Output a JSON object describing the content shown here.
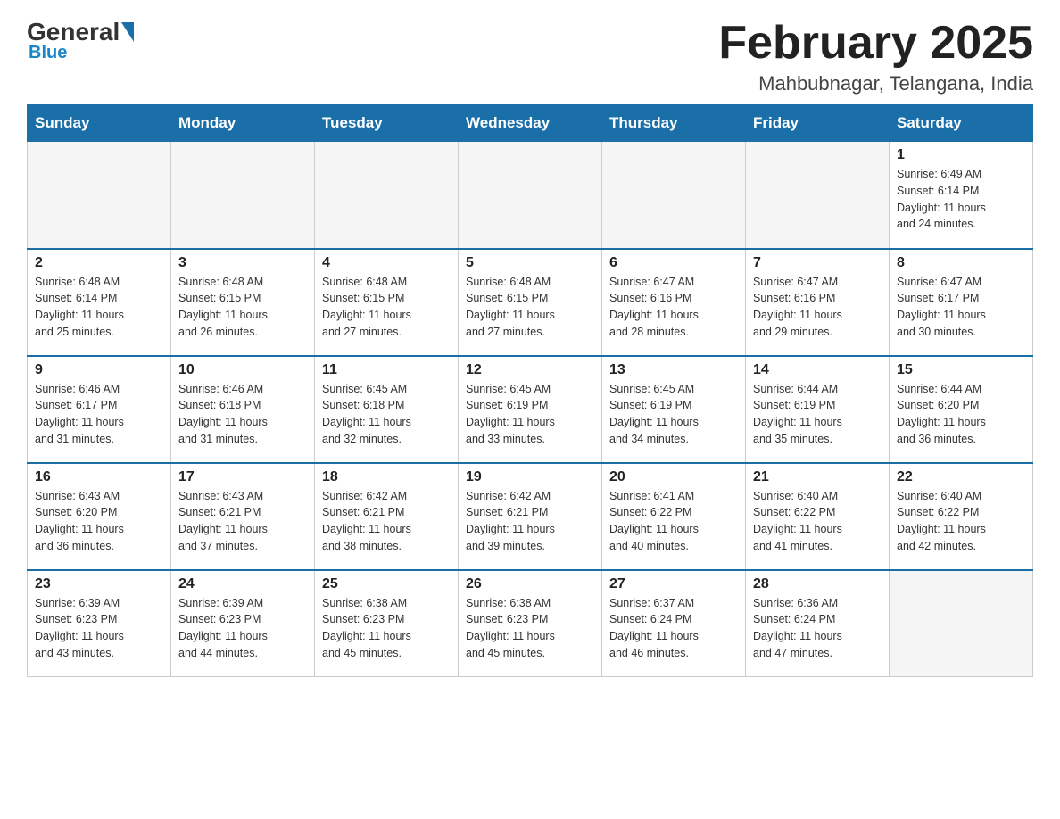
{
  "logo": {
    "general": "General",
    "blue": "Blue"
  },
  "title": "February 2025",
  "subtitle": "Mahbubnagar, Telangana, India",
  "headers": [
    "Sunday",
    "Monday",
    "Tuesday",
    "Wednesday",
    "Thursday",
    "Friday",
    "Saturday"
  ],
  "weeks": [
    [
      {
        "day": "",
        "info": ""
      },
      {
        "day": "",
        "info": ""
      },
      {
        "day": "",
        "info": ""
      },
      {
        "day": "",
        "info": ""
      },
      {
        "day": "",
        "info": ""
      },
      {
        "day": "",
        "info": ""
      },
      {
        "day": "1",
        "info": "Sunrise: 6:49 AM\nSunset: 6:14 PM\nDaylight: 11 hours\nand 24 minutes."
      }
    ],
    [
      {
        "day": "2",
        "info": "Sunrise: 6:48 AM\nSunset: 6:14 PM\nDaylight: 11 hours\nand 25 minutes."
      },
      {
        "day": "3",
        "info": "Sunrise: 6:48 AM\nSunset: 6:15 PM\nDaylight: 11 hours\nand 26 minutes."
      },
      {
        "day": "4",
        "info": "Sunrise: 6:48 AM\nSunset: 6:15 PM\nDaylight: 11 hours\nand 27 minutes."
      },
      {
        "day": "5",
        "info": "Sunrise: 6:48 AM\nSunset: 6:15 PM\nDaylight: 11 hours\nand 27 minutes."
      },
      {
        "day": "6",
        "info": "Sunrise: 6:47 AM\nSunset: 6:16 PM\nDaylight: 11 hours\nand 28 minutes."
      },
      {
        "day": "7",
        "info": "Sunrise: 6:47 AM\nSunset: 6:16 PM\nDaylight: 11 hours\nand 29 minutes."
      },
      {
        "day": "8",
        "info": "Sunrise: 6:47 AM\nSunset: 6:17 PM\nDaylight: 11 hours\nand 30 minutes."
      }
    ],
    [
      {
        "day": "9",
        "info": "Sunrise: 6:46 AM\nSunset: 6:17 PM\nDaylight: 11 hours\nand 31 minutes."
      },
      {
        "day": "10",
        "info": "Sunrise: 6:46 AM\nSunset: 6:18 PM\nDaylight: 11 hours\nand 31 minutes."
      },
      {
        "day": "11",
        "info": "Sunrise: 6:45 AM\nSunset: 6:18 PM\nDaylight: 11 hours\nand 32 minutes."
      },
      {
        "day": "12",
        "info": "Sunrise: 6:45 AM\nSunset: 6:19 PM\nDaylight: 11 hours\nand 33 minutes."
      },
      {
        "day": "13",
        "info": "Sunrise: 6:45 AM\nSunset: 6:19 PM\nDaylight: 11 hours\nand 34 minutes."
      },
      {
        "day": "14",
        "info": "Sunrise: 6:44 AM\nSunset: 6:19 PM\nDaylight: 11 hours\nand 35 minutes."
      },
      {
        "day": "15",
        "info": "Sunrise: 6:44 AM\nSunset: 6:20 PM\nDaylight: 11 hours\nand 36 minutes."
      }
    ],
    [
      {
        "day": "16",
        "info": "Sunrise: 6:43 AM\nSunset: 6:20 PM\nDaylight: 11 hours\nand 36 minutes."
      },
      {
        "day": "17",
        "info": "Sunrise: 6:43 AM\nSunset: 6:21 PM\nDaylight: 11 hours\nand 37 minutes."
      },
      {
        "day": "18",
        "info": "Sunrise: 6:42 AM\nSunset: 6:21 PM\nDaylight: 11 hours\nand 38 minutes."
      },
      {
        "day": "19",
        "info": "Sunrise: 6:42 AM\nSunset: 6:21 PM\nDaylight: 11 hours\nand 39 minutes."
      },
      {
        "day": "20",
        "info": "Sunrise: 6:41 AM\nSunset: 6:22 PM\nDaylight: 11 hours\nand 40 minutes."
      },
      {
        "day": "21",
        "info": "Sunrise: 6:40 AM\nSunset: 6:22 PM\nDaylight: 11 hours\nand 41 minutes."
      },
      {
        "day": "22",
        "info": "Sunrise: 6:40 AM\nSunset: 6:22 PM\nDaylight: 11 hours\nand 42 minutes."
      }
    ],
    [
      {
        "day": "23",
        "info": "Sunrise: 6:39 AM\nSunset: 6:23 PM\nDaylight: 11 hours\nand 43 minutes."
      },
      {
        "day": "24",
        "info": "Sunrise: 6:39 AM\nSunset: 6:23 PM\nDaylight: 11 hours\nand 44 minutes."
      },
      {
        "day": "25",
        "info": "Sunrise: 6:38 AM\nSunset: 6:23 PM\nDaylight: 11 hours\nand 45 minutes."
      },
      {
        "day": "26",
        "info": "Sunrise: 6:38 AM\nSunset: 6:23 PM\nDaylight: 11 hours\nand 45 minutes."
      },
      {
        "day": "27",
        "info": "Sunrise: 6:37 AM\nSunset: 6:24 PM\nDaylight: 11 hours\nand 46 minutes."
      },
      {
        "day": "28",
        "info": "Sunrise: 6:36 AM\nSunset: 6:24 PM\nDaylight: 11 hours\nand 47 minutes."
      },
      {
        "day": "",
        "info": ""
      }
    ]
  ]
}
